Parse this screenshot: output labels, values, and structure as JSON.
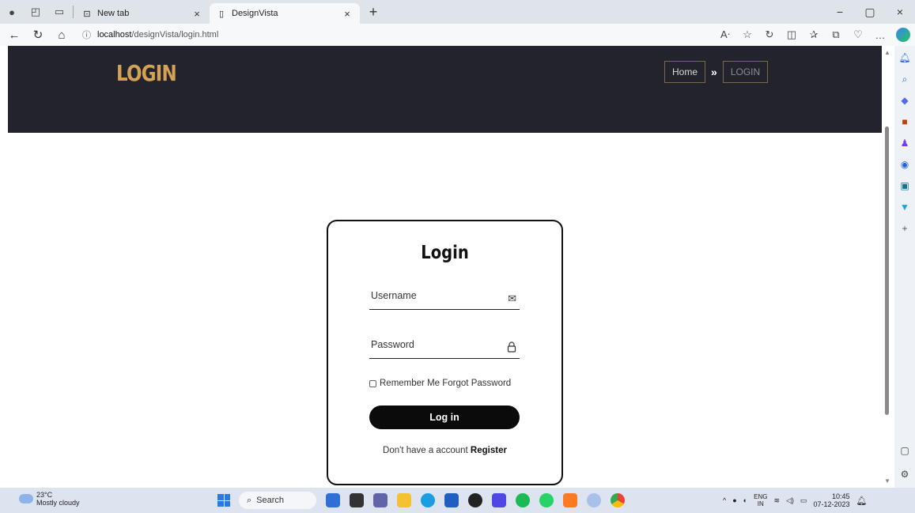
{
  "browser": {
    "tabs": [
      {
        "title": "New tab",
        "active": false,
        "icon": "new-tab-icon"
      },
      {
        "title": "DesignVista",
        "active": true,
        "icon": "page-icon"
      }
    ],
    "url_host": "localhost",
    "url_path": "/designVista/login.html"
  },
  "hero": {
    "title": "LOGIN",
    "breadcrumb_home": "Home",
    "breadcrumb_separator": "»",
    "breadcrumb_current": "LOGIN"
  },
  "login_card": {
    "title": "Login",
    "username_placeholder": "Username",
    "password_placeholder": "Password",
    "remember_label": "Remember Me",
    "forgot_label": "Forgot Password",
    "submit_label": "Log in",
    "register_prompt": "Don't have a account",
    "register_link": "Register"
  },
  "taskbar": {
    "temperature": "23°C",
    "weather": "Mostly cloudy",
    "search_label": "Search",
    "lang_top": "ENG",
    "lang_bottom": "IN",
    "time": "10:45",
    "date": "07-12-2023"
  },
  "colors": {
    "hero_background": "#23232d",
    "hero_title": "#d4a255",
    "button_background": "#0b0b0b"
  }
}
